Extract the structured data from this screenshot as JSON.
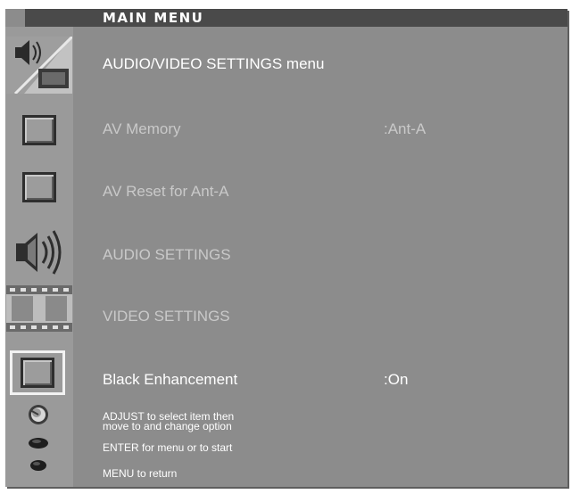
{
  "title": "MAIN MENU",
  "menu_items": [
    {
      "label": "AUDIO/VIDEO SETTINGS menu",
      "value": "",
      "icon": "speaker-film-icon",
      "state": "header"
    },
    {
      "label": "AV Memory",
      "value": ":Ant-A",
      "icon": "square-button-icon",
      "state": "normal"
    },
    {
      "label": "AV Reset for Ant-A",
      "value": "",
      "icon": "square-button-icon",
      "state": "normal"
    },
    {
      "label": "AUDIO SETTINGS",
      "value": "",
      "icon": "speaker-icon",
      "state": "normal"
    },
    {
      "label": "VIDEO SETTINGS",
      "value": "",
      "icon": "film-icon",
      "state": "normal"
    },
    {
      "label": "Black Enhancement",
      "value": ":On",
      "icon": "square-button-icon",
      "state": "selected"
    }
  ],
  "help": [
    {
      "text_lines": [
        "ADJUST to select item then",
        "move to and change option"
      ],
      "icon": "adjust-knob-icon"
    },
    {
      "text_lines": [
        "ENTER for menu or to start"
      ],
      "icon": "enter-button-icon"
    },
    {
      "text_lines": [
        "MENU to return"
      ],
      "icon": "menu-button-icon"
    }
  ],
  "colors": {
    "panel": "#8c8c8c",
    "title_bar": "#4a4a4a",
    "text_dim": "#c9c9c9",
    "text_active": "#ffffff",
    "selection_frame": "#f2f2f2"
  }
}
